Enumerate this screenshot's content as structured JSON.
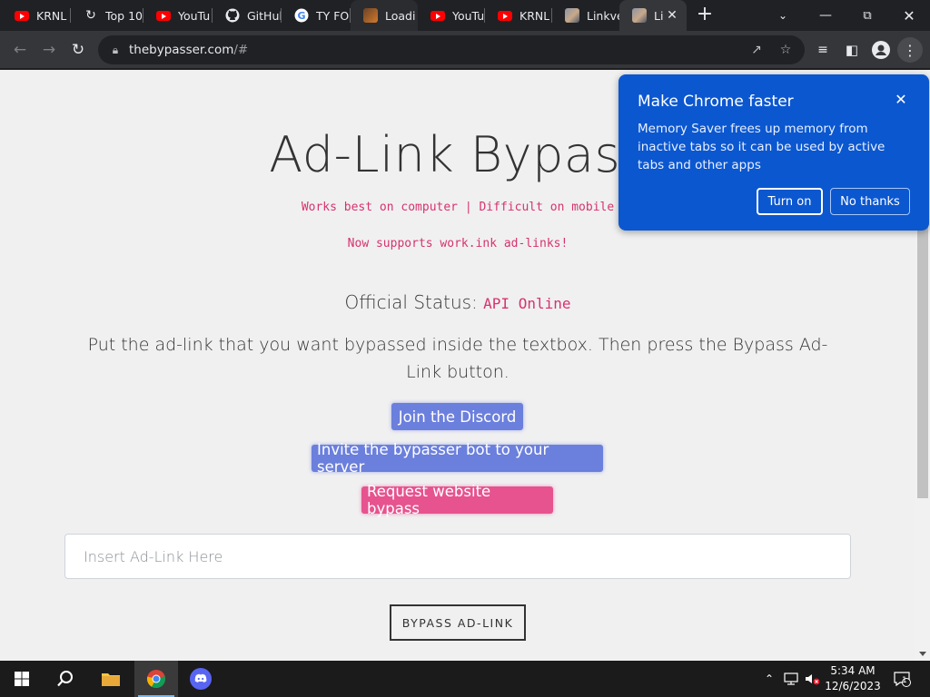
{
  "tabs": [
    {
      "title": "KRNL l",
      "icon": "youtube-icon"
    },
    {
      "title": "Top 10",
      "icon": "loading-icon"
    },
    {
      "title": "YouTu",
      "icon": "youtube-icon"
    },
    {
      "title": "GitHul",
      "icon": "github-icon"
    },
    {
      "title": "TY FOI",
      "icon": "google-icon"
    },
    {
      "title": "Loadi",
      "icon": "image-icon"
    },
    {
      "title": "YouTu",
      "icon": "youtube-icon"
    },
    {
      "title": "KRNL",
      "icon": "youtube-icon"
    },
    {
      "title": "Linkve",
      "icon": "image-icon"
    },
    {
      "title": "Li",
      "icon": "image-icon"
    }
  ],
  "address": {
    "host": "thebypasser.com",
    "path": "/#"
  },
  "page": {
    "title": "Ad-Link Bypass",
    "subtitle": "Works best on computer | Difficult on mobile",
    "notice": "Now supports work.ink ad-links!",
    "status_label": "Official Status:",
    "status_value": "API Online",
    "instructions": "Put the ad-link that you want bypassed inside the textbox. Then press the Bypass Ad-Link button.",
    "discord_button": "Join the Discord",
    "invite_button": "Invite the bypasser bot to your server",
    "request_button": "Request website bypass",
    "input_placeholder": "Insert Ad-Link Here",
    "bypass_button": "BYPASS AD-LINK"
  },
  "popup": {
    "title": "Make Chrome faster",
    "body": "Memory Saver frees up memory from inactive tabs so it can be used by active tabs and other apps",
    "turn_on": "Turn on",
    "no_thanks": "No thanks"
  },
  "taskbar": {
    "time": "5:34 AM",
    "date": "12/6/2023",
    "notification_count": "1"
  },
  "colors": {
    "accent_pink": "#d6336c",
    "button_blue": "#6b7fdc",
    "button_pink": "#e6538f",
    "popup_blue": "#0b57d0"
  }
}
